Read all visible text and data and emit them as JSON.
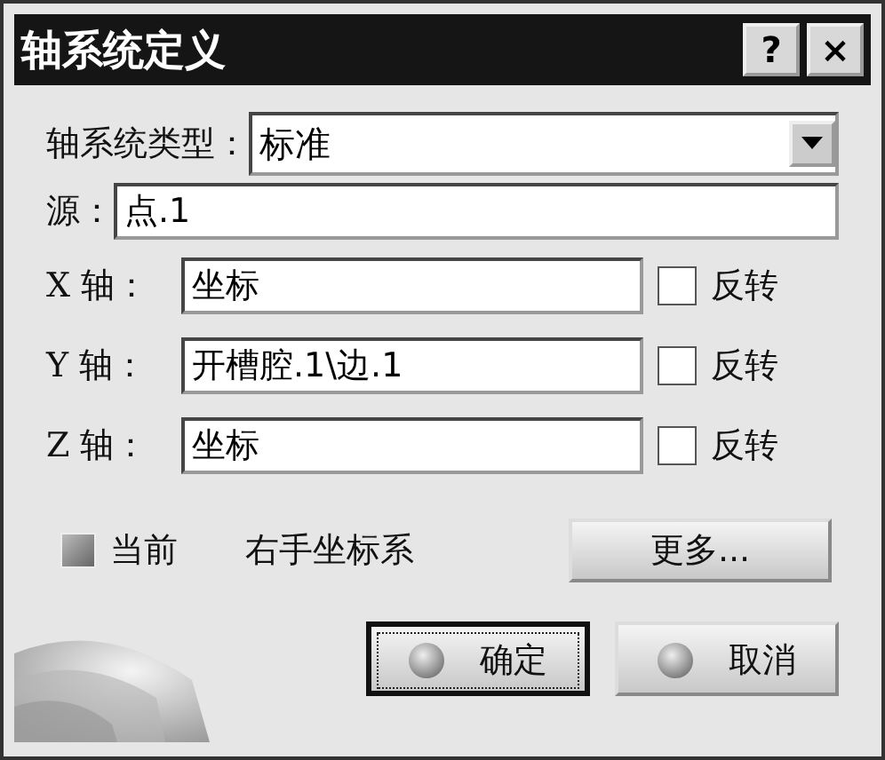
{
  "window": {
    "title": "轴系统定义",
    "help_button": "?",
    "close_button": "×"
  },
  "type_field": {
    "label": "轴系统类型：",
    "value": "标准"
  },
  "origin_field": {
    "label": "源：",
    "value": "点.1"
  },
  "axes": [
    {
      "label": "X 轴：",
      "value": "坐标",
      "reverse_label": "反转",
      "reverse_checked": false
    },
    {
      "label": "Y 轴：",
      "value": "开槽腔.1\\边.1",
      "reverse_label": "反转",
      "reverse_checked": false
    },
    {
      "label": "Z 轴：",
      "value": "坐标",
      "reverse_label": "反转",
      "reverse_checked": false
    }
  ],
  "current": {
    "label": "当前",
    "on": true
  },
  "handedness": "右手坐标系",
  "more_button": "更多...",
  "buttons": [
    {
      "label": "确定",
      "default": true
    },
    {
      "label": "取消",
      "default": false
    }
  ]
}
